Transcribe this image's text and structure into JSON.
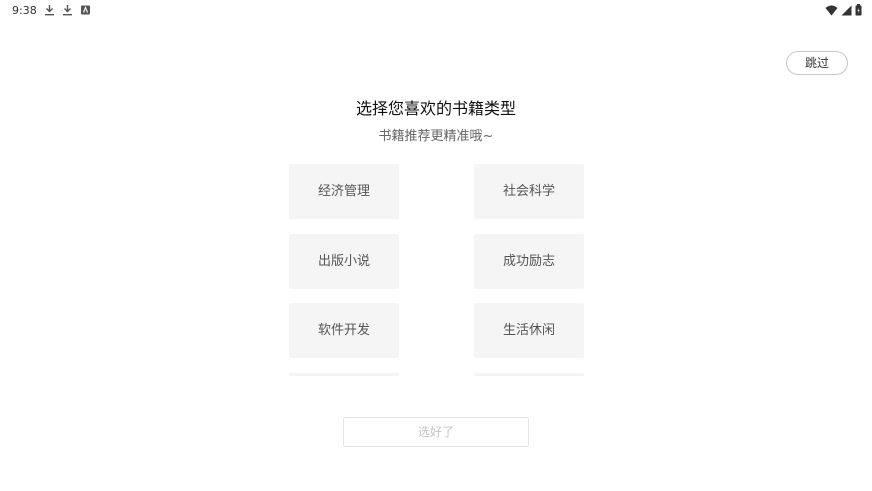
{
  "status_bar": {
    "time": "9:38",
    "left_icons": [
      "download-icon",
      "download-icon",
      "app-notification-icon"
    ],
    "right_icons": [
      "wifi-icon",
      "cellular-signal-icon",
      "battery-icon"
    ]
  },
  "header": {
    "skip_label": "跳过"
  },
  "main": {
    "title": "选择您喜欢的书籍类型",
    "subtitle": "书籍推荐更精准哦~",
    "categories": [
      {
        "label": "经济管理"
      },
      {
        "label": "社会科学"
      },
      {
        "label": "出版小说"
      },
      {
        "label": "成功励志"
      },
      {
        "label": "软件开发"
      },
      {
        "label": "生活休闲"
      }
    ]
  },
  "footer": {
    "confirm_label": "选好了",
    "confirm_enabled": false
  },
  "colors": {
    "tile_background": "#f5f5f5",
    "tile_text": "#555555",
    "disabled_text": "#c4c4c4"
  }
}
